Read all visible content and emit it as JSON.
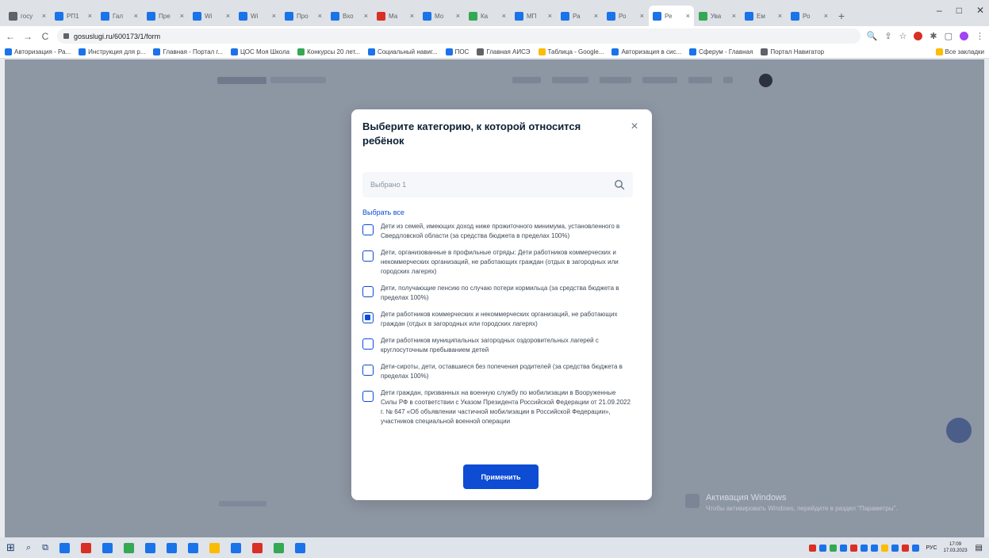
{
  "browser": {
    "tabs": [
      {
        "title": "госу",
        "color": "#5f6368"
      },
      {
        "title": "РП1",
        "color": "#1a73e8"
      },
      {
        "title": "Гал",
        "color": "#1a73e8"
      },
      {
        "title": "Пре",
        "color": "#1a73e8"
      },
      {
        "title": "Wi",
        "color": "#1a73e8"
      },
      {
        "title": "Wi",
        "color": "#1a73e8"
      },
      {
        "title": "Про",
        "color": "#1a73e8"
      },
      {
        "title": "Вхо",
        "color": "#1a73e8"
      },
      {
        "title": "Ма",
        "color": "#d93025"
      },
      {
        "title": "Мо",
        "color": "#1a73e8"
      },
      {
        "title": "Ка",
        "color": "#34a853"
      },
      {
        "title": "МП",
        "color": "#1a73e8"
      },
      {
        "title": "Ра",
        "color": "#1a73e8"
      },
      {
        "title": "Ро",
        "color": "#1a73e8"
      },
      {
        "title": "Ре",
        "color": "#1a73e8"
      },
      {
        "title": "Ува",
        "color": "#34a853"
      },
      {
        "title": "Ем",
        "color": "#1a73e8"
      },
      {
        "title": "Ро",
        "color": "#1a73e8"
      }
    ],
    "active_tab_index": 14,
    "new_tab": "+",
    "window_controls": {
      "minimize": "–",
      "maximize": "□",
      "close": "✕"
    },
    "address": "gosuslugi.ru/600173/1/form",
    "nav": {
      "back": "←",
      "forward": "→",
      "reload": "C"
    },
    "bookmarks": [
      {
        "label": "Авторизация - Ра...",
        "color": "#1a73e8"
      },
      {
        "label": "Инструкция для р...",
        "color": "#1a73e8"
      },
      {
        "label": "Главная - Портал г...",
        "color": "#1a73e8"
      },
      {
        "label": "ЦОС Моя Школа",
        "color": "#1a73e8"
      },
      {
        "label": "Конкурсы 20 лет...",
        "color": "#34a853"
      },
      {
        "label": "Социальный навиг...",
        "color": "#1a73e8"
      },
      {
        "label": "ПОС",
        "color": "#1a73e8"
      },
      {
        "label": "Главная АИСЭ",
        "color": "#5f6368"
      },
      {
        "label": "Таблица - Google...",
        "color": "#fbbc04"
      },
      {
        "label": "Авторизация в сис...",
        "color": "#1a73e8"
      },
      {
        "label": "Сферум - Главная",
        "color": "#1a73e8"
      },
      {
        "label": "Портал Навигатор",
        "color": "#5f6368"
      }
    ],
    "bookmarks_other": "Все закладки"
  },
  "modal": {
    "title": "Выберите категорию, к которой относится ребёнок",
    "close_icon": "×",
    "search_placeholder": "Выбрано 1",
    "select_all": "Выбрать все",
    "items": [
      {
        "text": "Дети из семей, имеющих доход ниже прожиточного минимума, установленного в Свердловской области (за средства бюджета в пределах 100%)",
        "checked": false
      },
      {
        "text": "Дети, организованные в профильные отряды: Дети работников коммерческих и некоммерческих организаций, не работающих граждан (отдых в загородных или городских лагерях)",
        "checked": false
      },
      {
        "text": "Дети, получающие пенсию по случаю потери кормильца (за средства бюджета в пределах 100%)",
        "checked": false
      },
      {
        "text": "Дети работников коммерческих и некоммерческих организаций, не работающих граждан (отдых в загородных или городских лагерях)",
        "checked": true
      },
      {
        "text": "Дети работников муниципальных загородных оздоровительных лагерей с круглосуточным пребыванием детей",
        "checked": false
      },
      {
        "text": "Дети-сироты, дети, оставшиеся без попечения родителей (за средства бюджета в пределах 100%)",
        "checked": false
      },
      {
        "text": "Дети граждан, призванных на военную службу по мобилизации в Вооруженные Силы РФ в соответствии с Указом Президента Российской Федерации от 21.09.2022 г. № 647 «Об объявлении частичной мобилизации в Российской Федерации», участников специальной военной операции",
        "checked": false
      }
    ],
    "apply": "Применить"
  },
  "background": {
    "activation_title": "Активация Windows",
    "activation_sub": "Чтобы активировать Windows, перейдите в раздел \"Параметры\"."
  },
  "taskbar": {
    "apps": [
      "#1a73e8",
      "#d93025",
      "#1a73e8",
      "#34a853",
      "#1a73e8",
      "#1a73e8",
      "#1a73e8",
      "#fbbc04",
      "#1a73e8",
      "#d93025",
      "#34a853",
      "#1a73e8"
    ],
    "tray_icons": [
      "#d93025",
      "#1a73e8",
      "#34a853",
      "#1a73e8",
      "#d93025",
      "#1a73e8",
      "#1a73e8",
      "#fbbc04",
      "#1a73e8",
      "#d93025",
      "#1a73e8"
    ],
    "lang": "РУС",
    "time": "17:09",
    "date": "17.03.2023"
  }
}
